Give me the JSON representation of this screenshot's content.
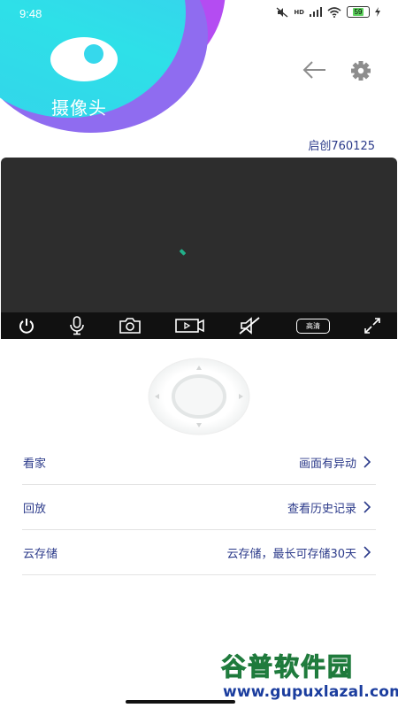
{
  "status_bar": {
    "time": "9:48",
    "network_label": "HD",
    "battery_level": "59"
  },
  "header": {
    "app_title": "摄像头",
    "device_name": "启创760125"
  },
  "video": {
    "quality_label": "高清"
  },
  "menu": {
    "items": [
      {
        "label": "看家",
        "value": "画面有异动"
      },
      {
        "label": "回放",
        "value": "查看历史记录"
      },
      {
        "label": "云存储",
        "value": "云存储，最长可存储30天"
      }
    ]
  },
  "watermark": {
    "title": "谷普软件园",
    "url": "www.gupuxlazal.com"
  },
  "colors": {
    "accent_text": "#2b3a8a",
    "blob_cyan": "#2ee0e8",
    "blob_purple": "#8f6cf0",
    "video_bg": "#2d2d2d",
    "control_bar": "#111111"
  }
}
